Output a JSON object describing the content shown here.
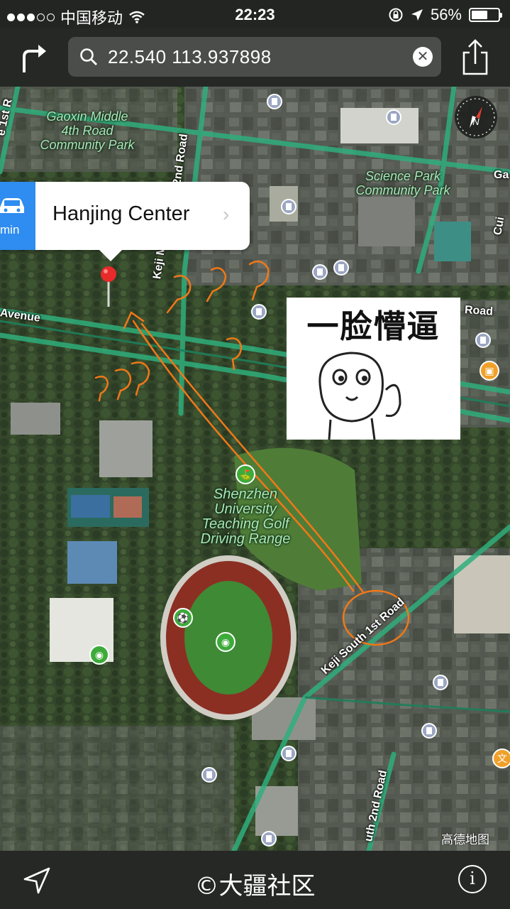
{
  "status_bar": {
    "carrier": "中国移动",
    "time": "22:23",
    "battery": "56%",
    "battery_level": 0.56
  },
  "search": {
    "query": "22.540 113.937898"
  },
  "callout": {
    "mins_label": "min",
    "place_name": "Hanjing Center"
  },
  "map_labels": {
    "park_1": "Gaoxin Middle\n4th Road\nCommunity Park",
    "park_2": "Science Park\nCommunity Park",
    "golf": "Shenzhen\nUniversity\nTeaching Golf\nDriving Range",
    "road_keji_south_1st": "Keji South 1st Road",
    "road_keji_south_2nd": "uth 2nd Road",
    "road_avenue": "Avenue",
    "road_top_right": "Road",
    "road_2nd_road_top": "2nd Road",
    "road_1st_rd_topleft": "e 1st R",
    "road_keji_mid": "Keji M",
    "edge_ga": "Ga",
    "edge_cui": "Cui"
  },
  "meme": {
    "caption": "一脸懵逼"
  },
  "map_provider": "高德地图",
  "bottom_bar": {
    "watermark": "©大疆社区",
    "info_label": "i"
  },
  "icons": [
    "signal-dots-icon",
    "wifi-icon",
    "rotation-lock-icon",
    "location-arrow-icon",
    "battery-icon",
    "turn-right-arrow-icon",
    "search-icon",
    "clear-icon",
    "share-icon",
    "compass-icon",
    "car-icon",
    "chevron-right-icon",
    "map-pin-icon",
    "building-poi-icon",
    "golf-poi-icon",
    "sports-poi-icon",
    "stadium-poi-icon",
    "current-location-icon",
    "info-icon"
  ],
  "colors": {
    "route_line": "#f07818",
    "road_green": "#2fae7c",
    "callout_accent": "#2f8cf0",
    "pin_red": "#e82a2a"
  }
}
